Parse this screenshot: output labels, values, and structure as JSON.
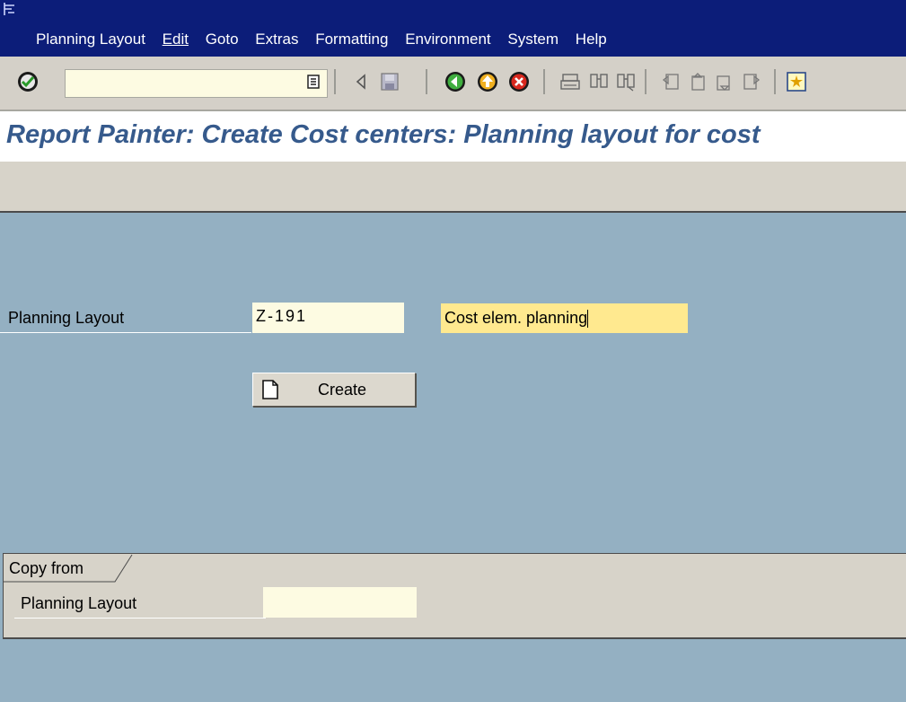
{
  "menubar": {
    "items": [
      "Planning Layout",
      "Edit",
      "Goto",
      "Extras",
      "Formatting",
      "Environment",
      "System",
      "Help"
    ]
  },
  "toolbar": {
    "command_field_value": "",
    "icons": [
      "enter-icon",
      "save-icon",
      "back-icon",
      "exit-icon",
      "cancel-icon",
      "print-icon",
      "find-icon",
      "find-next-icon",
      "first-page-icon",
      "previous-page-icon",
      "next-page-icon",
      "last-page-icon",
      "layout-icon"
    ]
  },
  "title": "Report Painter: Create Cost centers: Planning layout for cost",
  "form": {
    "planning_layout_label": "Planning Layout",
    "planning_layout_value": "Z-191",
    "description_value": "Cost elem. planning",
    "create_button_label": "Create"
  },
  "copy_from": {
    "tab_label": "Copy from",
    "planning_layout_label": "Planning Layout",
    "planning_layout_value": ""
  },
  "colors": {
    "menubar_bg": "#0c1d79",
    "body_bg": "#94b0c2",
    "title_color": "#365a8c",
    "field_bg": "#fdfbe2",
    "active_field_bg": "#ffe98f"
  }
}
